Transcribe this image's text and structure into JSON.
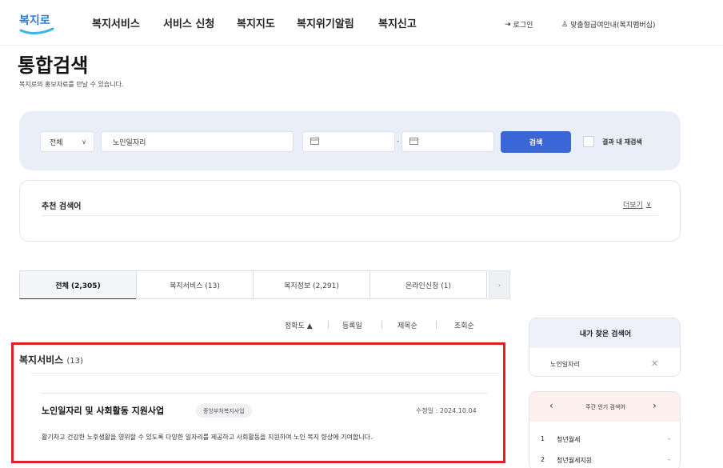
{
  "header": {
    "logo_text": "복지로",
    "nav": [
      "복지서비스",
      "서비스 신청",
      "복지지도",
      "복지위기알림",
      "복지신고"
    ],
    "login_label": "로그인",
    "custom_benefit_label": "맞춤형급여안내(복지멤버십)"
  },
  "page": {
    "title": "통합검색",
    "subtitle": "복지로의 홍보자료를 만날 수 있습니다."
  },
  "search": {
    "scope": "전체",
    "keyword": "노인일자리",
    "date_separator": "-",
    "button": "검색",
    "refine_label": "결과 내 재검색"
  },
  "recommended": {
    "title": "추천 검색어",
    "more": "더보기"
  },
  "tabs": [
    {
      "label": "전체 (2,305)",
      "active": true
    },
    {
      "label": "복지서비스 (13)",
      "active": false
    },
    {
      "label": "복지정보 (2,291)",
      "active": false
    },
    {
      "label": "온라인신청 (1)",
      "active": false
    }
  ],
  "sort": [
    "정확도 ▲",
    "등록일",
    "제목순",
    "조회순"
  ],
  "results": {
    "section_title": "복지서비스",
    "section_count": "(13)",
    "item": {
      "title": "노인일자리 및 사회활동 지원사업",
      "tag": "중앙부처복지사업",
      "date_label": "수정일 : 2024.10.04",
      "description": "활기차고 건강한 노후생활을 영위할 수 있도록 다양한 일자리를 제공하고 사회활동을 지원하여 노인 복지 향상에 기여합니다."
    }
  },
  "sidebar": {
    "my_searches_title": "내가 찾은 검색어",
    "my_searches": [
      "노인일자리"
    ],
    "popular_title": "주간 인기 검색어",
    "popular": [
      {
        "rank": "1",
        "label": "청년월세",
        "trend": "-"
      },
      {
        "rank": "2",
        "label": "청년월세지원",
        "trend": "-"
      }
    ]
  },
  "colors": {
    "accent": "#3b66d6",
    "highlight": "#e01f26",
    "search_panel_bg": "#e9eef8"
  }
}
